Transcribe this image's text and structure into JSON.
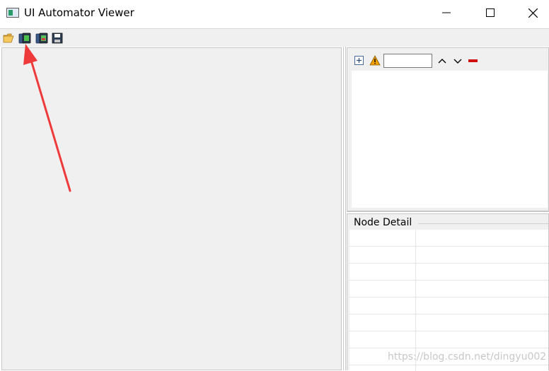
{
  "window": {
    "title": "UI Automator Viewer"
  },
  "icons": {
    "app": "app-window-icon",
    "minimize": "minimize-icon",
    "maximize": "maximize-icon",
    "close": "close-icon",
    "open": "folder-open-icon",
    "device_screenshot": "device-screenshot-icon",
    "device_screenshot_compressed": "device-screenshot-compressed-icon",
    "save": "save-icon",
    "expand_all": "expand-all-icon",
    "warning": "warning-icon",
    "previous": "chevron-up-icon",
    "next": "chevron-down-icon",
    "clear": "clear-icon"
  },
  "hierarchy": {
    "search_value": ""
  },
  "node_detail": {
    "title": "Node Detail",
    "rows": 8
  },
  "watermark": "https://blog.csdn.net/dingyu002",
  "colors": {
    "annotation_arrow": "#ee3a3a",
    "clear_icon": "#d01010",
    "warning_icon": "#f0a000"
  }
}
